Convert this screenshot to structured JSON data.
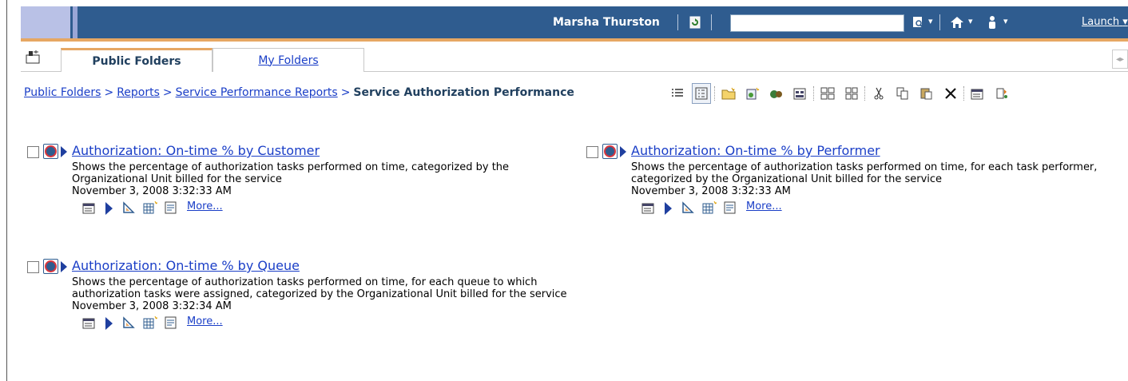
{
  "banner": {
    "user_name": "Marsha Thurston",
    "search_value": "",
    "launch_label": "Launch",
    "dropdown_glyph": "▾",
    "icons": [
      "refresh-icon",
      "search-options-icon",
      "home-icon",
      "user-icon"
    ]
  },
  "tabs": [
    {
      "label": "Public Folders",
      "active": true
    },
    {
      "label": "My Folders",
      "active": false
    }
  ],
  "breadcrumb": {
    "items": [
      "Public Folders",
      "Reports",
      "Service Performance Reports"
    ],
    "separator": ">",
    "current": "Service Authorization Performance"
  },
  "toolbar": {
    "icons": [
      "list-view-icon",
      "details-view-icon",
      "new-folder-icon",
      "new-report-icon",
      "new-job-icon",
      "new-page-icon",
      "order-icon",
      "group-icon",
      "cut-icon",
      "copy-icon",
      "paste-icon",
      "delete-icon",
      "properties-icon",
      "set-properties-icon"
    ]
  },
  "entries": [
    {
      "title": "Authorization: On-time % by Customer",
      "description": "Shows the percentage of authorization tasks performed on time, categorized by the Organizational Unit billed for the service",
      "timestamp": "November 3, 2008 3:32:33 AM",
      "more_label": "More..."
    },
    {
      "title": "Authorization: On-time % by Performer",
      "description": "Shows the percentage of authorization tasks performed on time, for each task performer, categorized by the Organizational Unit billed for the service",
      "timestamp": "November 3, 2008 3:32:33 AM",
      "more_label": "More..."
    },
    {
      "title": "Authorization: On-time % by Queue",
      "description": "Shows the percentage of authorization tasks performed on time, for each queue to which authorization tasks were assigned, categorized by the Organizational Unit billed for the service",
      "timestamp": "November 3, 2008 3:32:34 AM",
      "more_label": "More..."
    }
  ],
  "colors": {
    "banner": "#2f5c8f",
    "accent_orange": "#e6a763",
    "link": "#1a3ec7",
    "heading": "#21405f"
  }
}
